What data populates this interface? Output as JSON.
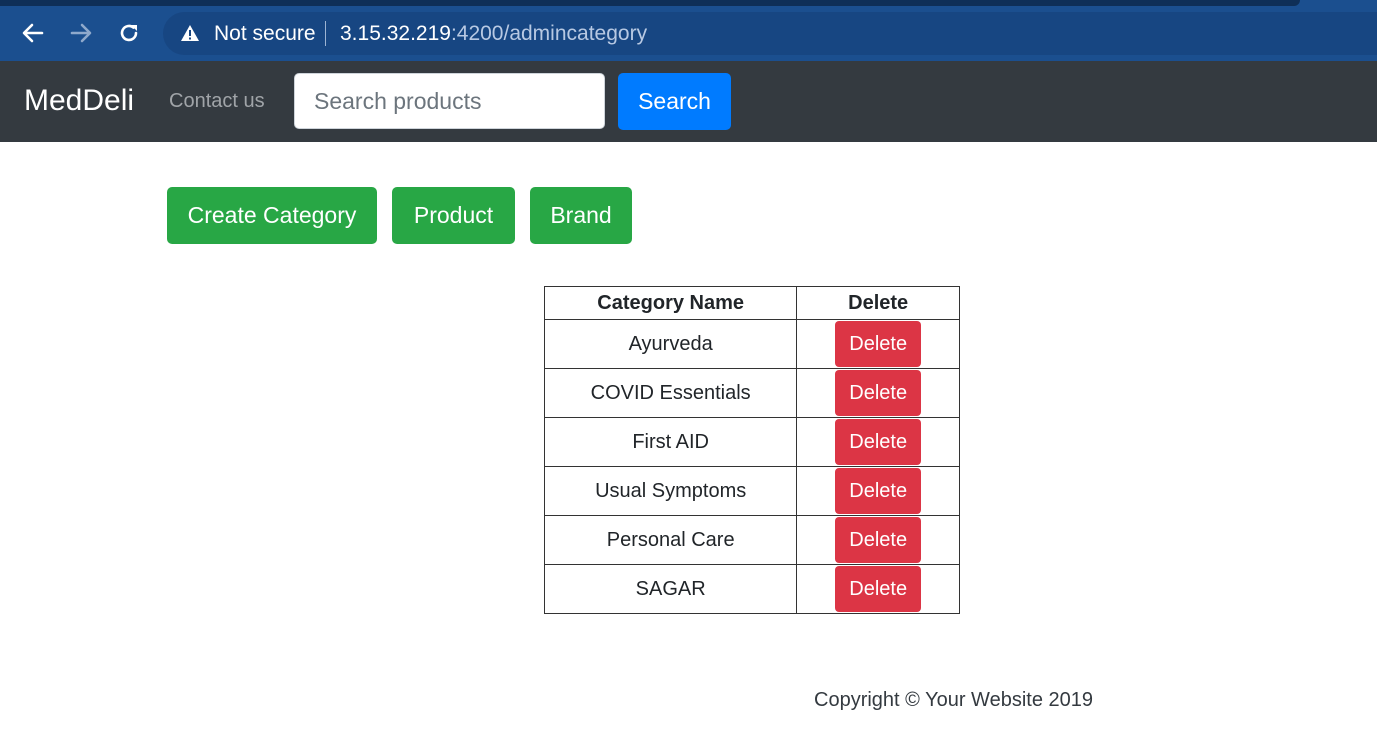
{
  "browser": {
    "security_label": "Not secure",
    "url_host": "3.15.32.219",
    "url_path": ":4200/admincategory",
    "icons": [
      "back-arrow-icon",
      "forward-arrow-icon",
      "reload-icon",
      "warning-icon"
    ]
  },
  "navbar": {
    "brand": "MedDeli",
    "contact_link": "Contact us",
    "search_placeholder": "Search products",
    "search_button": "Search"
  },
  "actions": {
    "create_category": "Create Category",
    "product": "Product",
    "brand": "Brand"
  },
  "table": {
    "headers": [
      "Category Name",
      "Delete"
    ],
    "rows": [
      {
        "name": "Ayurveda",
        "action": "Delete"
      },
      {
        "name": "COVID Essentials",
        "action": "Delete"
      },
      {
        "name": "First AID",
        "action": "Delete"
      },
      {
        "name": "Usual Symptoms",
        "action": "Delete"
      },
      {
        "name": "Personal Care",
        "action": "Delete"
      },
      {
        "name": "SAGAR",
        "action": "Delete"
      }
    ]
  },
  "footer": {
    "copyright": "Copyright © Your Website 2019"
  },
  "colors": {
    "navbar_bg": "#343a40",
    "primary": "#007bff",
    "success": "#28a745",
    "danger": "#dc3545"
  }
}
